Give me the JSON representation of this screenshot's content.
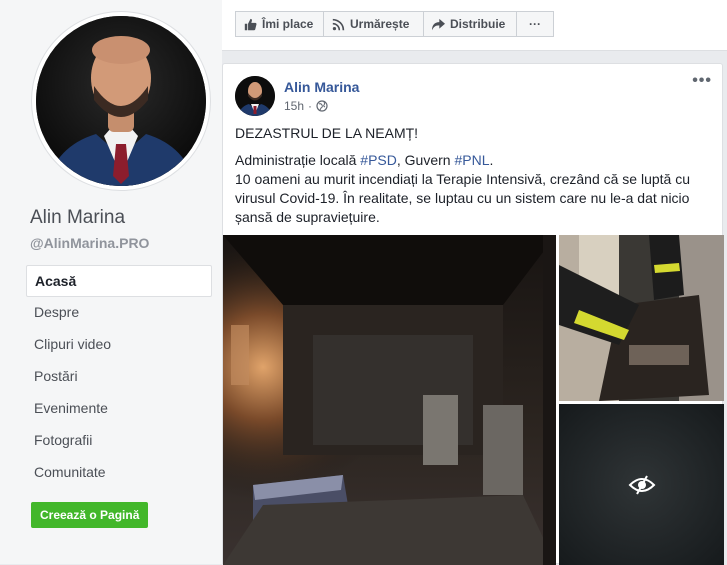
{
  "profile": {
    "name": "Alin Marina",
    "handle": "@AlinMarina.PRO"
  },
  "nav": {
    "items": [
      {
        "label": "Acasă",
        "active": true
      },
      {
        "label": "Despre",
        "active": false
      },
      {
        "label": "Clipuri video",
        "active": false
      },
      {
        "label": "Postări",
        "active": false
      },
      {
        "label": "Evenimente",
        "active": false
      },
      {
        "label": "Fotografii",
        "active": false
      },
      {
        "label": "Comunitate",
        "active": false
      }
    ],
    "create_page_label": "Creează o Pagină"
  },
  "actions": {
    "like_label": "Îmi place",
    "follow_label": "Urmărește",
    "share_label": "Distribuie",
    "more_label": "···"
  },
  "post": {
    "author": "Alin Marina",
    "time": "15h",
    "more_label": "•••",
    "headline": "DEZASTRUL DE LA NEAMȚ!",
    "line2_prefix": "Administrație locală ",
    "hashtag1": "#PSD",
    "line2_mid": ", Guvern ",
    "hashtag2": "#PNL",
    "line2_suffix": ".",
    "body": "10 oameni au murit incendiați la Terapie Intensivă, crezând că se luptă cu virusul Covid-19. În realitate, se luptau cu un sistem care nu le-a dat nicio șansă de supraviețuire."
  },
  "colors": {
    "link": "#365899",
    "green": "#42b72a",
    "page_bg": "#e9ebee"
  }
}
